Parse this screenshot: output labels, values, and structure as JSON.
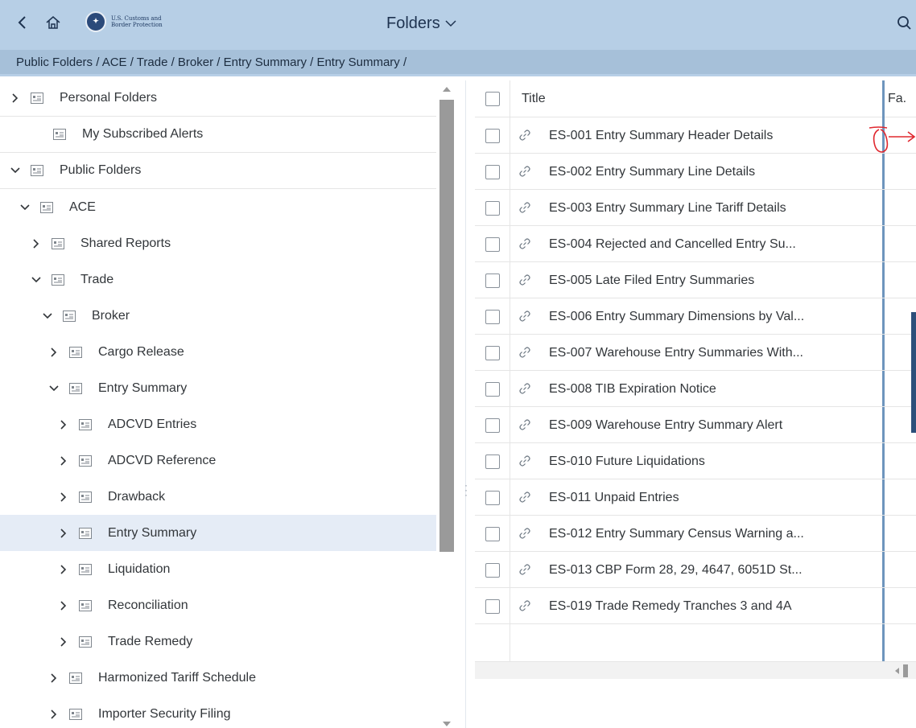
{
  "shell": {
    "logo_text": "U.S. Customs and Border Protection",
    "title": "Folders",
    "colors": {
      "shell_bg": "#b7cfe6",
      "breadcrumb_bg": "#a6c0d9",
      "selected_row": "#e5ecf6",
      "accent": "#6e95bd"
    }
  },
  "breadcrumb": {
    "path": "Public Folders / ACE / Trade / Broker / Entry Summary / Entry Summary /"
  },
  "tree": {
    "items": [
      {
        "label": "Personal Folders",
        "expanded": false
      },
      {
        "label": "My Subscribed Alerts",
        "expanded": null
      },
      {
        "label": "Public Folders",
        "expanded": true
      },
      {
        "label": "ACE",
        "expanded": true
      },
      {
        "label": "Shared Reports",
        "expanded": false
      },
      {
        "label": "Trade",
        "expanded": true
      },
      {
        "label": "Broker",
        "expanded": true
      },
      {
        "label": "Cargo Release",
        "expanded": false
      },
      {
        "label": "Entry Summary",
        "expanded": true
      },
      {
        "label": "ADCVD Entries",
        "expanded": false
      },
      {
        "label": "ADCVD Reference",
        "expanded": false
      },
      {
        "label": "Drawback",
        "expanded": false
      },
      {
        "label": "Entry Summary",
        "expanded": false,
        "selected": true
      },
      {
        "label": "Liquidation",
        "expanded": false
      },
      {
        "label": "Reconciliation",
        "expanded": false
      },
      {
        "label": "Trade Remedy",
        "expanded": false
      },
      {
        "label": "Harmonized Tariff Schedule",
        "expanded": false
      },
      {
        "label": "Importer Security Filing",
        "expanded": false
      }
    ]
  },
  "table": {
    "columns": {
      "title": "Title",
      "fav": "Fa."
    },
    "rows": [
      "ES-001 Entry Summary Header Details",
      "ES-002 Entry Summary Line Details",
      "ES-003 Entry Summary Line Tariff Details",
      "ES-004 Rejected and Cancelled Entry Su...",
      "ES-005 Late Filed Entry Summaries",
      "ES-006 Entry Summary Dimensions by Val...",
      "ES-007 Warehouse Entry Summaries With...",
      "ES-008 TIB Expiration Notice",
      "ES-009 Warehouse Entry Summary Alert",
      "ES-010 Future Liquidations",
      "ES-011 Unpaid Entries",
      "ES-012 Entry Summary Census Warning a...",
      "ES-013 CBP Form 28, 29, 4647, 6051D St...",
      "ES-019 Trade Remedy Tranches 3 and 4A"
    ]
  }
}
